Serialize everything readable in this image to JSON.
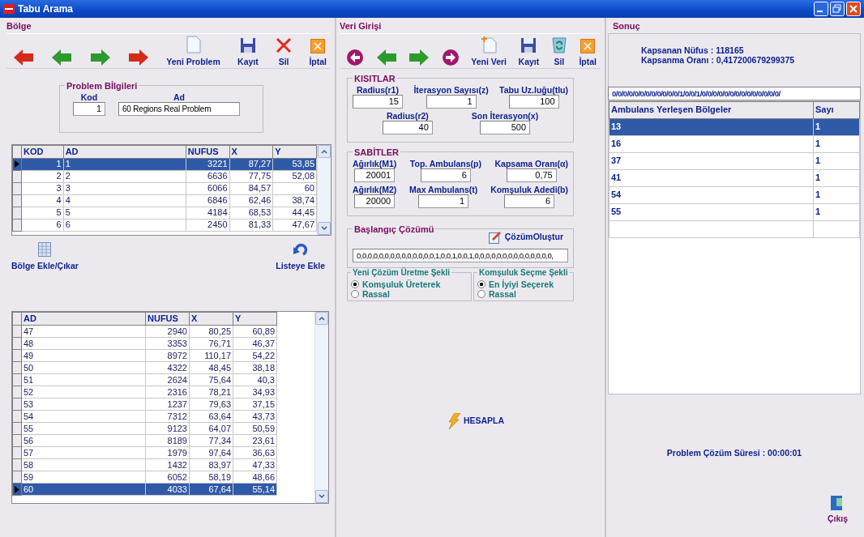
{
  "window": {
    "title": "Tabu Arama"
  },
  "region_panel": {
    "title": "Bölge",
    "toolbar": [
      {
        "kind": "first"
      },
      {
        "kind": "prev"
      },
      {
        "kind": "next"
      },
      {
        "kind": "last"
      },
      {
        "kind": "new",
        "label": "Yeni Problem"
      },
      {
        "kind": "save",
        "label": "Kayıt"
      },
      {
        "kind": "delete",
        "label": "Sil"
      },
      {
        "kind": "cancel",
        "label": "İptal"
      }
    ],
    "problem_info": {
      "title": "Problem Bİlgileri",
      "fields": [
        {
          "label": "Kod",
          "value": "1"
        },
        {
          "label": "Ad",
          "value": "60 Regions Real Problem"
        }
      ]
    },
    "regions_table": {
      "columns": [
        "KOD",
        "AD",
        "NUFUS",
        "X",
        "Y"
      ],
      "rows": [
        {
          "cells": [
            "1",
            "1",
            "3221",
            "87,27",
            "53,85"
          ],
          "selected": true
        },
        {
          "cells": [
            "2",
            "2",
            "6636",
            "77,75",
            "52,08"
          ],
          "selected": false
        },
        {
          "cells": [
            "3",
            "3",
            "6066",
            "84,57",
            "60"
          ],
          "selected": false
        },
        {
          "cells": [
            "4",
            "4",
            "6846",
            "62,46",
            "38,74"
          ],
          "selected": false
        },
        {
          "cells": [
            "5",
            "5",
            "4184",
            "68,53",
            "44,45"
          ],
          "selected": false
        },
        {
          "cells": [
            "6",
            "6",
            "2450",
            "81,33",
            "47,67"
          ],
          "selected": false
        }
      ]
    },
    "actions": [
      {
        "kind": "grid",
        "label": "Bölge Ekle/Çıkar"
      },
      {
        "kind": "undo",
        "label": "Listeye Ekle"
      }
    ],
    "list_table": {
      "columns": [
        "AD",
        "NUFUS",
        "X",
        "Y"
      ],
      "rows": [
        {
          "cells": [
            "47",
            "2940",
            "80,25",
            "60,89"
          ],
          "selected": false
        },
        {
          "cells": [
            "48",
            "3353",
            "76,71",
            "46,37"
          ],
          "selected": false
        },
        {
          "cells": [
            "49",
            "8972",
            "110,17",
            "54,22"
          ],
          "selected": false
        },
        {
          "cells": [
            "50",
            "4322",
            "48,45",
            "38,18"
          ],
          "selected": false
        },
        {
          "cells": [
            "51",
            "2624",
            "75,64",
            "40,3"
          ],
          "selected": false
        },
        {
          "cells": [
            "52",
            "2316",
            "78,21",
            "34,93"
          ],
          "selected": false
        },
        {
          "cells": [
            "53",
            "1237",
            "79,63",
            "37,15"
          ],
          "selected": false
        },
        {
          "cells": [
            "54",
            "7312",
            "63,64",
            "43,73"
          ],
          "selected": false
        },
        {
          "cells": [
            "55",
            "9123",
            "64,07",
            "50,59"
          ],
          "selected": false
        },
        {
          "cells": [
            "56",
            "8189",
            "77,34",
            "23,61"
          ],
          "selected": false
        },
        {
          "cells": [
            "57",
            "1979",
            "97,64",
            "36,63"
          ],
          "selected": false
        },
        {
          "cells": [
            "58",
            "1432",
            "83,97",
            "47,33"
          ],
          "selected": false
        },
        {
          "cells": [
            "59",
            "6052",
            "58,19",
            "48,66"
          ],
          "selected": false
        },
        {
          "cells": [
            "60",
            "4033",
            "67,64",
            "55,14"
          ],
          "selected": true
        }
      ]
    }
  },
  "data_panel": {
    "title": "Veri Girişi",
    "toolbar": [
      {
        "kind": "circle-left"
      },
      {
        "kind": "prev"
      },
      {
        "kind": "next"
      },
      {
        "kind": "circle-right"
      },
      {
        "kind": "new-plus",
        "label": "Yeni Veri"
      },
      {
        "kind": "save",
        "label": "Kayıt"
      },
      {
        "kind": "recycle",
        "label": "Sil"
      },
      {
        "kind": "cancel",
        "label": "İptal"
      }
    ],
    "constraints": {
      "title": "KISITLAR",
      "rows": [
        [
          {
            "label": "Radius(r1)",
            "value": "15"
          },
          {
            "label": "İterasyon Sayısı(z)",
            "value": "1"
          },
          {
            "label": "Tabu Uz.luğu(tlu)",
            "value": "100"
          }
        ],
        [
          {
            "label": "Radius(r2)",
            "value": "40"
          },
          {
            "label": "Son İterasyon(x)",
            "value": "500"
          }
        ]
      ]
    },
    "constants": {
      "title": "SABİTLER",
      "rows": [
        [
          {
            "label": "Ağırlık(M1)",
            "value": "20001"
          },
          {
            "label": "Top. Ambulans(p)",
            "value": "6"
          },
          {
            "label": "Kapsama Oranı(α)",
            "value": "0,75"
          }
        ],
        [
          {
            "label": "Ağırlık(M2)",
            "value": "20000"
          },
          {
            "label": "Max Ambulans(t)",
            "value": "1"
          },
          {
            "label": "Komşuluk Adedi(b)",
            "value": "6"
          }
        ]
      ]
    },
    "initial_solution": {
      "title": "Başlangıç Çözümü",
      "button": "ÇözümOluştur",
      "value": "0,0,0,0,0,0,0,0,0,0,0,0,0,0,1,0,0,1,0,0,1,0,0,0,0,0,0,0,0,0,0,0,0,0,0,"
    },
    "radio_groups": [
      {
        "title": "Yeni Çözüm Üretme Şekli",
        "options": [
          {
            "label": "Komşuluk Üreterek",
            "selected": true
          },
          {
            "label": "Rassal",
            "selected": false
          }
        ]
      },
      {
        "title": "Komşuluk Seçme Şekli",
        "options": [
          {
            "label": "En İyiyi Seçerek",
            "selected": true
          },
          {
            "label": "Rassal",
            "selected": false
          }
        ]
      }
    ],
    "calculate_button": "HESAPLA"
  },
  "result_panel": {
    "title": "Sonuç",
    "covered_population": "Kapsanan Nüfus : 118165",
    "coverage_ratio": "Kapsanma Oranı : 0,417200679299375",
    "solution_vector": "0/0/0/0/0/0/0/0/0/0/0/0/1/0/0/1/0/0/0/0/0/0/0/0/0/0/0/0/0/0/",
    "table": {
      "columns": [
        "Ambulans Yerleşen Bölgeler",
        "Sayı"
      ],
      "rows": [
        {
          "cells": [
            "13",
            "1"
          ],
          "selected": true
        },
        {
          "cells": [
            "16",
            "1"
          ],
          "selected": false
        },
        {
          "cells": [
            "37",
            "1"
          ],
          "selected": false
        },
        {
          "cells": [
            "41",
            "1"
          ],
          "selected": false
        },
        {
          "cells": [
            "54",
            "1"
          ],
          "selected": false
        },
        {
          "cells": [
            "55",
            "1"
          ],
          "selected": false
        }
      ]
    },
    "solve_time": "Problem Çözüm Süresi : 00:00:01",
    "exit_button": "Çıkış"
  }
}
